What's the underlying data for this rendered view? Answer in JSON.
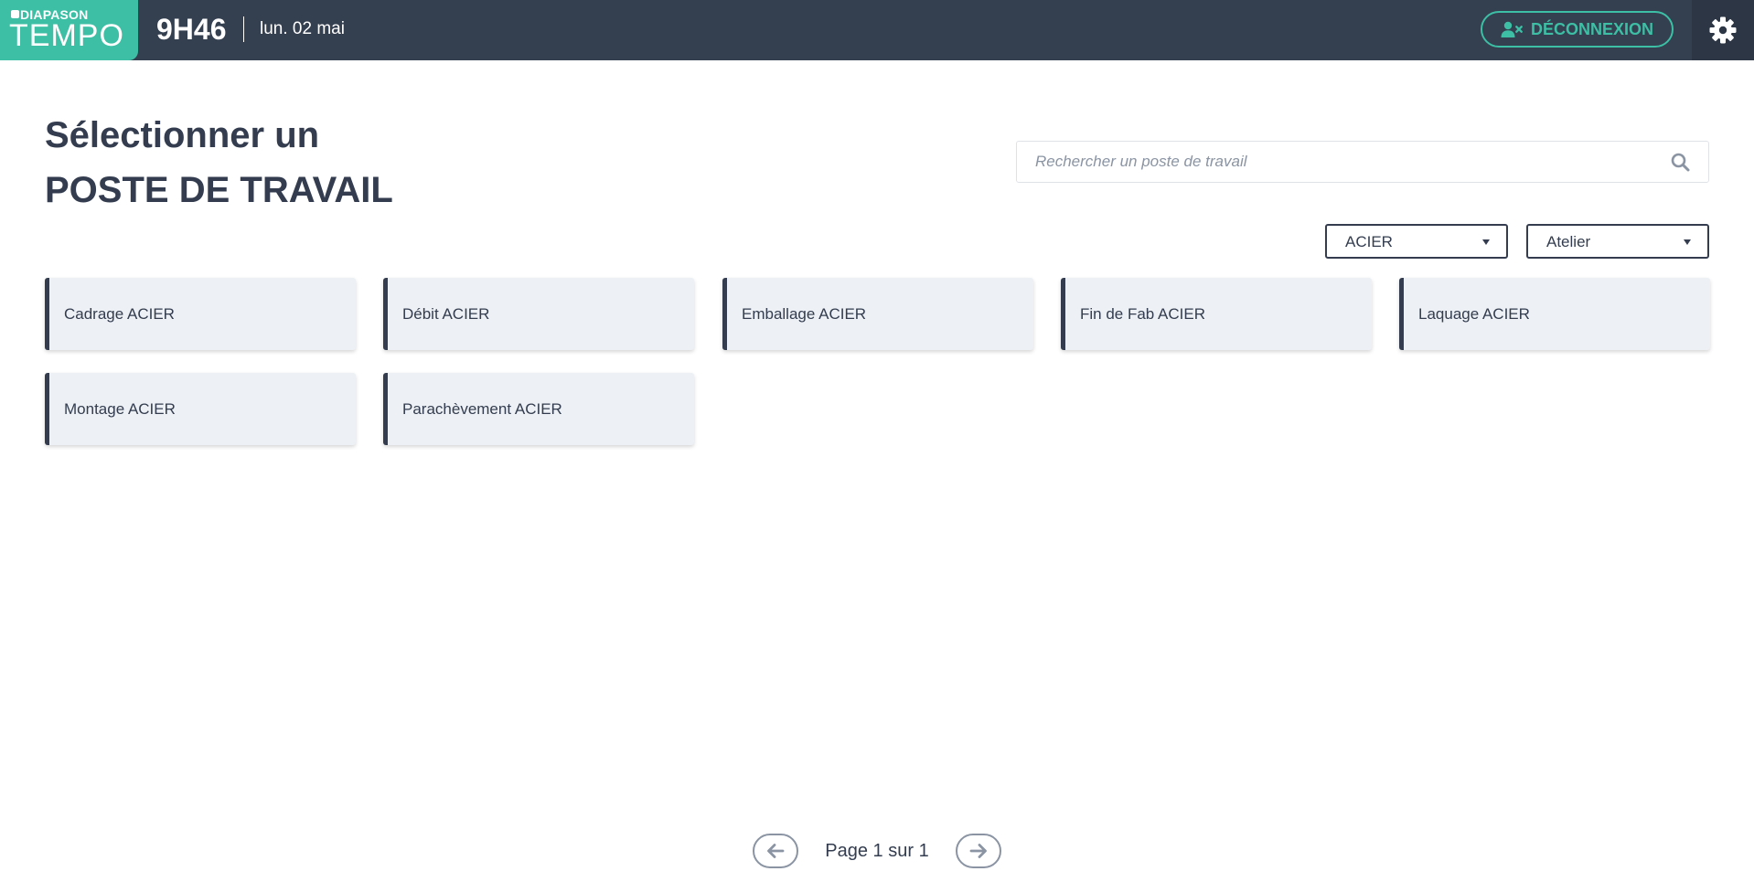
{
  "header": {
    "logo": {
      "brand_top": "DIAPASON",
      "brand_bottom": "TEMPO"
    },
    "time": "9H46",
    "date": "lun. 02 mai",
    "logout_label": "DÉCONNEXION"
  },
  "title": {
    "line1": "Sélectionner un",
    "line2": "POSTE DE TRAVAIL"
  },
  "search": {
    "placeholder": "Rechercher un poste de travail",
    "value": ""
  },
  "filters": {
    "material_selected": "ACIER",
    "workshop_selected": "Atelier"
  },
  "workstations": [
    {
      "label": "Cadrage ACIER"
    },
    {
      "label": "Débit ACIER"
    },
    {
      "label": "Emballage ACIER"
    },
    {
      "label": "Fin de Fab ACIER"
    },
    {
      "label": "Laquage ACIER"
    },
    {
      "label": "Montage ACIER"
    },
    {
      "label": "Parachèvement ACIER"
    }
  ],
  "pagination": {
    "text": "Page 1 sur 1"
  },
  "colors": {
    "header_bg": "#343f50",
    "accent": "#3cbfa4",
    "text_dark": "#333d4f",
    "card_bg": "#edf0f4",
    "muted": "#8a94a3"
  },
  "icons": {
    "logout": "user-times-icon",
    "settings": "gear-icon",
    "search": "search-icon",
    "prev": "arrow-left-icon",
    "next": "arrow-right-icon",
    "dropdown": "caret-down-icon"
  }
}
